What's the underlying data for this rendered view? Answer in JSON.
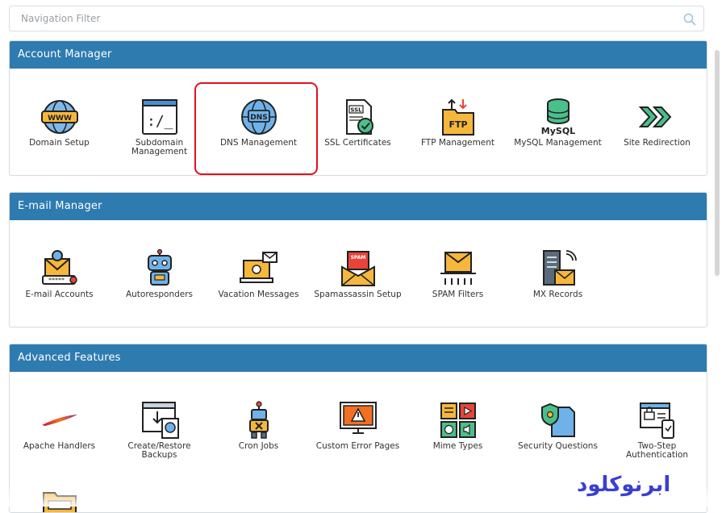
{
  "filter": {
    "placeholder": "Navigation Filter"
  },
  "sections": {
    "account": {
      "title": "Account Manager",
      "items": [
        {
          "label": "Domain Setup",
          "icon": "globe-www-icon"
        },
        {
          "label": "Subdomain Management",
          "icon": "terminal-window-icon"
        },
        {
          "label": "DNS Management",
          "icon": "dns-globe-icon"
        },
        {
          "label": "SSL Certificates",
          "icon": "ssl-certificate-icon"
        },
        {
          "label": "FTP Management",
          "icon": "ftp-folder-icon"
        },
        {
          "label": "MySQL Management",
          "icon": "mysql-database-icon"
        },
        {
          "label": "Site Redirection",
          "icon": "redirect-arrows-icon"
        }
      ]
    },
    "email": {
      "title": "E-mail Manager",
      "items": [
        {
          "label": "E-mail Accounts",
          "icon": "email-account-icon"
        },
        {
          "label": "Autoresponders",
          "icon": "robot-icon"
        },
        {
          "label": "Vacation Messages",
          "icon": "laptop-mail-icon"
        },
        {
          "label": "Spamassassin Setup",
          "icon": "spam-envelope-icon"
        },
        {
          "label": "SPAM Filters",
          "icon": "spam-filter-icon"
        },
        {
          "label": "MX Records",
          "icon": "mx-server-icon"
        }
      ]
    },
    "advanced": {
      "title": "Advanced Features",
      "items": [
        {
          "label": "Apache Handlers",
          "icon": "apache-feather-icon"
        },
        {
          "label": "Create/Restore Backups",
          "icon": "backup-icon"
        },
        {
          "label": "Cron Jobs",
          "icon": "robot-clock-icon"
        },
        {
          "label": "Custom Error Pages",
          "icon": "error-monitor-icon"
        },
        {
          "label": "Mime Types",
          "icon": "media-types-icon"
        },
        {
          "label": "Security Questions",
          "icon": "security-shield-icon"
        },
        {
          "label": "Two-Step Authentication",
          "icon": "two-step-lock-icon"
        }
      ]
    }
  },
  "brand": {
    "text": "ابرنوکلود"
  },
  "colors": {
    "header": "#2e7bb0",
    "highlight": "#e3101c",
    "brand": "#3a3fd1"
  }
}
